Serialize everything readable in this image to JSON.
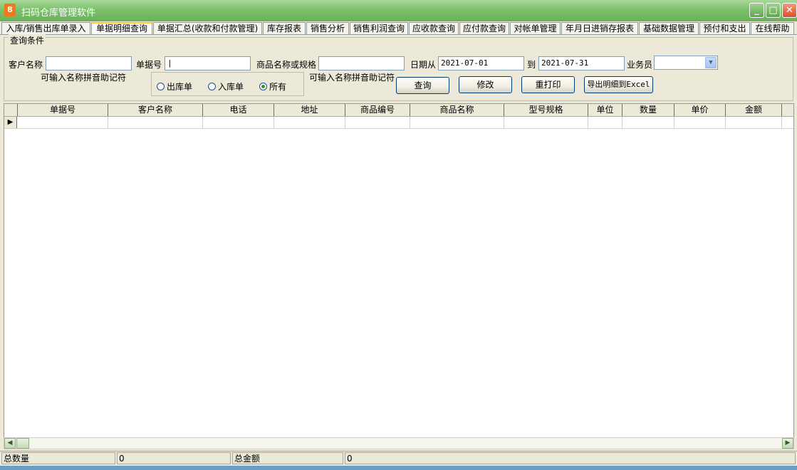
{
  "window": {
    "title": "扫码仓库管理软件",
    "icon": "app-logo-icon",
    "minimize": "_",
    "maximize": "□",
    "close": "✕"
  },
  "tabs": [
    {
      "label": "入库/销售出库单录入"
    },
    {
      "label": "单据明细查询",
      "active": true
    },
    {
      "label": "单据汇总(收款和付款管理)"
    },
    {
      "label": "库存报表"
    },
    {
      "label": "销售分析"
    },
    {
      "label": "销售利润查询"
    },
    {
      "label": "应收款查询"
    },
    {
      "label": "应付款查询"
    },
    {
      "label": "对帐单管理"
    },
    {
      "label": "年月日进销存报表"
    },
    {
      "label": "基础数据管理"
    },
    {
      "label": "预付和支出"
    },
    {
      "label": "在线帮助"
    }
  ],
  "query": {
    "legend": "查询条件",
    "customer_label": "客户名称",
    "customer_value": "",
    "customer_hint": "可输入名称拼音助记符",
    "docno_label": "单据号",
    "docno_value": "|",
    "product_label": "商品名称或规格",
    "product_value": "",
    "product_hint": "可输入名称拼音助记符",
    "date_from_label": "日期从",
    "date_from": "2021-07-01",
    "date_to_label": "到",
    "date_to": "2021-07-31",
    "salesman_label": "业务员",
    "salesman_value": "",
    "radios": [
      {
        "label": "出库单",
        "checked": false
      },
      {
        "label": "入库单",
        "checked": false
      },
      {
        "label": "所有",
        "checked": true
      }
    ],
    "buttons": {
      "search": "查询",
      "edit": "修改",
      "reprint": "重打印",
      "export": "导出明细到Excel"
    }
  },
  "grid": {
    "columns": [
      "单据号",
      "客户名称",
      "电话",
      "地址",
      "商品编号",
      "商品名称",
      "型号规格",
      "单位",
      "数量",
      "单价",
      "金额"
    ],
    "row_indicator": "▶"
  },
  "scroll": {
    "left": "◀",
    "right": "▶"
  },
  "status": {
    "total_qty_label": "总数量",
    "total_qty": "0",
    "total_amount_label": "总金额",
    "total_amount": "0"
  }
}
